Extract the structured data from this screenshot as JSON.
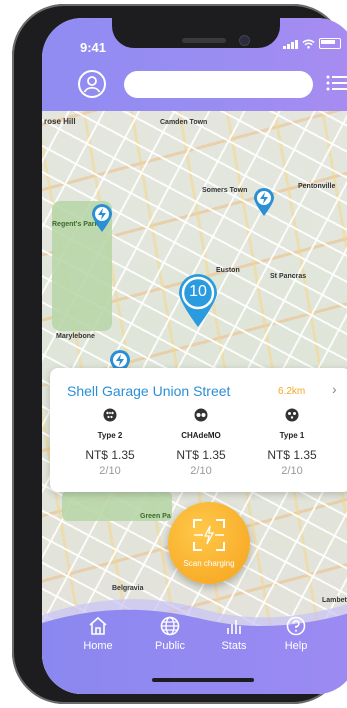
{
  "status_bar": {
    "time": "9:41"
  },
  "header": {
    "search_placeholder": ""
  },
  "map": {
    "labels": {
      "camden_town": "Camden Town",
      "somers_town": "Somers Town",
      "pentonville": "Pentonville",
      "regents_park": "Regent's Park",
      "euston": "Euston",
      "st_pancras": "St Pancras",
      "marylebone": "Marylebone",
      "belgravia": "Belgravia",
      "lambeth": "Lambet",
      "green_park": "Green Pa",
      "primrose_hill": "rose Hill"
    },
    "cluster_count": "10"
  },
  "station_card": {
    "name": "Shell Garage Union Street",
    "distance": "6.2km",
    "connectors": [
      {
        "type": "Type 2",
        "price": "NT$ 1.35",
        "availability": "2/10"
      },
      {
        "type": "CHAdeMO",
        "price": "NT$ 1.35",
        "availability": "2/10"
      },
      {
        "type": "Type 1",
        "price": "NT$ 1.35",
        "availability": "2/10"
      }
    ]
  },
  "scan_button": {
    "label": "Scan charging"
  },
  "tabs": [
    {
      "label": "Home"
    },
    {
      "label": "Public"
    },
    {
      "label": "Stats"
    },
    {
      "label": "Help"
    }
  ],
  "colors": {
    "header_gradient_start": "#8f8cf2",
    "accent_blue": "#2b8fd6",
    "accent_orange": "#f5a623",
    "tabbar_purple": "#8f84ee"
  }
}
